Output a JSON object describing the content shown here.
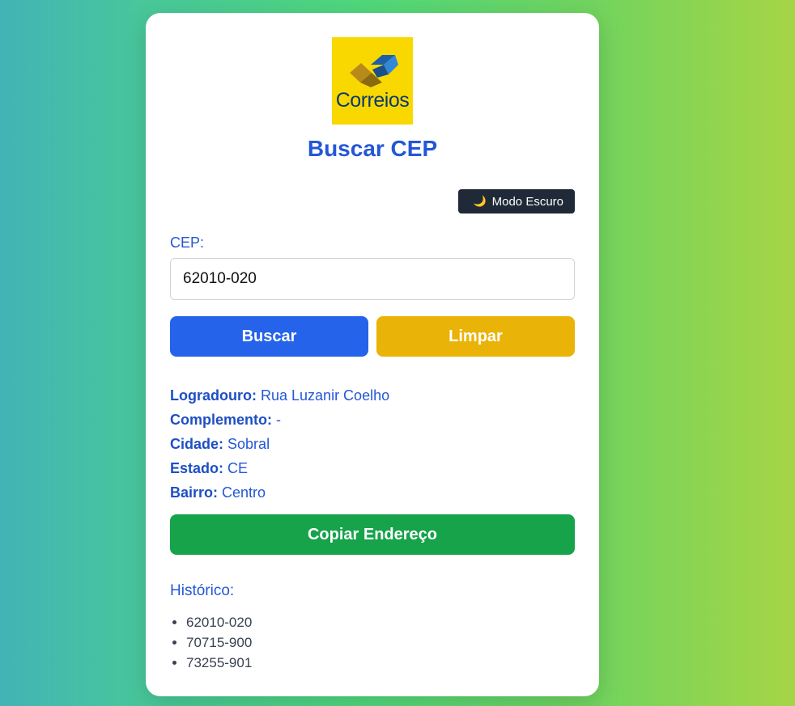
{
  "app": {
    "logo_text": "Correios",
    "title": "Buscar CEP",
    "dark_mode_label": "Modo Escuro",
    "dark_mode_icon": "moon-icon"
  },
  "form": {
    "cep_label": "CEP:",
    "cep_value": "62010-020",
    "search_label": "Buscar",
    "clear_label": "Limpar"
  },
  "result": {
    "rows": [
      {
        "label": "Logradouro:",
        "value": "Rua Luzanir Coelho"
      },
      {
        "label": "Complemento:",
        "value": "-"
      },
      {
        "label": "Cidade:",
        "value": "Sobral"
      },
      {
        "label": "Estado:",
        "value": "CE"
      },
      {
        "label": "Bairro:",
        "value": "Centro"
      }
    ],
    "copy_label": "Copiar Endereço"
  },
  "history": {
    "title": "Histórico:",
    "items": [
      "62010-020",
      "70715-900",
      "73255-901"
    ]
  },
  "colors": {
    "accent": "#2457d6",
    "search_button": "#2563eb",
    "clear_button": "#eab308",
    "copy_button": "#16a34a",
    "dark_button": "#1f2937",
    "logo_background": "#f9d800"
  }
}
